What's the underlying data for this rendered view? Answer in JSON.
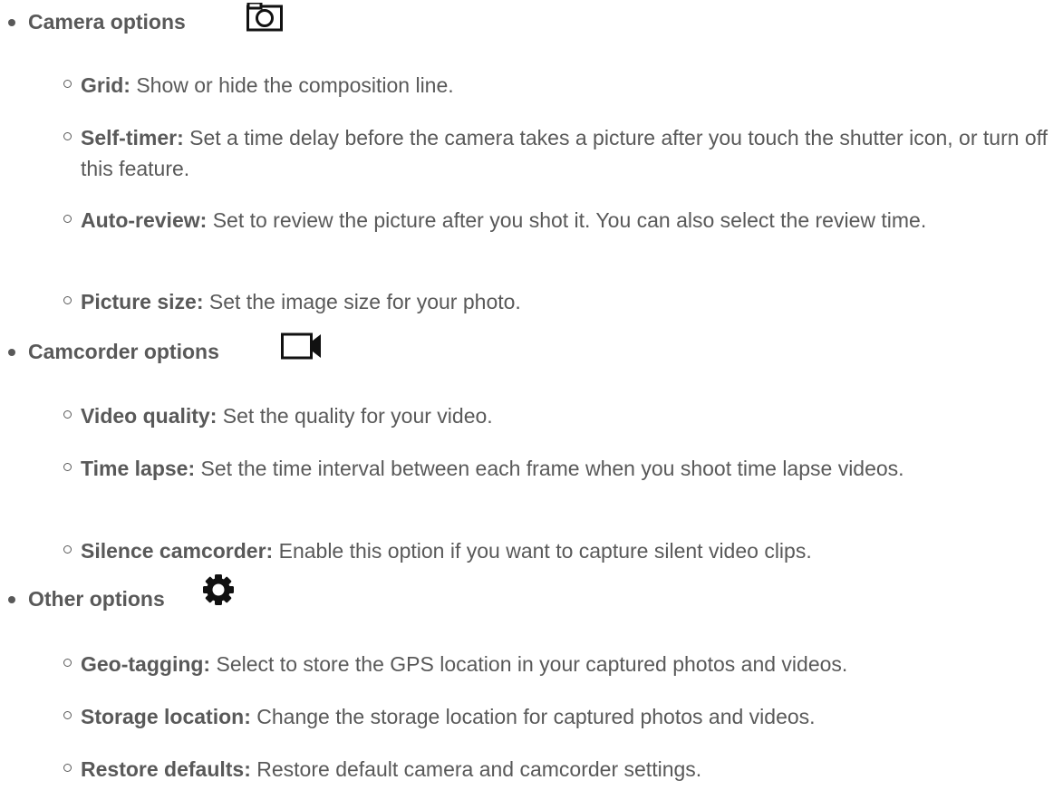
{
  "sections": [
    {
      "title": "Camera options",
      "icon": "camera-options-icon",
      "items": [
        {
          "term": "Grid:",
          "desc": "Show or hide the composition line."
        },
        {
          "term": "Self-timer:",
          "desc": "Set a time delay before the camera takes a picture after you touch the shutter icon, or turn off this feature."
        },
        {
          "term": "Auto-review:",
          "desc": "Set to review the picture after you shot it. You can also select the review time."
        },
        {
          "term": "Picture size:",
          "desc": "Set the image size for your photo."
        }
      ]
    },
    {
      "title": "Camcorder options",
      "icon": "camcorder-options-icon",
      "items": [
        {
          "term": "Video quality:",
          "desc": "Set the quality for your video."
        },
        {
          "term": "Time lapse:",
          "desc": "Set the time interval between each frame when you shoot time lapse videos."
        },
        {
          "term": "Silence camcorder:",
          "desc": "Enable this option if you want to capture silent video clips."
        }
      ]
    },
    {
      "title": "Other options",
      "icon": "gear-icon",
      "items": [
        {
          "term": "Geo-tagging:",
          "desc": "Select to store the GPS location in your captured photos and videos."
        },
        {
          "term": "Storage location:",
          "desc": "Change the storage location for captured photos and videos."
        },
        {
          "term": "Restore defaults:",
          "desc": "Restore default camera and camcorder settings."
        }
      ]
    }
  ]
}
